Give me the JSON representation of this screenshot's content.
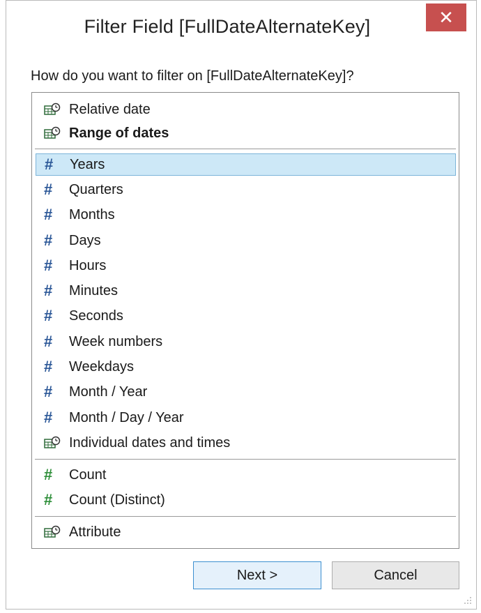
{
  "dialog": {
    "title": "Filter Field [FullDateAlternateKey]",
    "close_label": "✕",
    "prompt": "How do you want to filter on [FullDateAlternateKey]?"
  },
  "list": {
    "group1": [
      {
        "label": "Relative date",
        "icon": "date-time-icon",
        "bold": false
      },
      {
        "label": "Range of dates",
        "icon": "date-time-icon",
        "bold": true
      }
    ],
    "group2": [
      {
        "label": "Years",
        "icon": "hash-icon",
        "selected": true
      },
      {
        "label": "Quarters",
        "icon": "hash-icon"
      },
      {
        "label": "Months",
        "icon": "hash-icon"
      },
      {
        "label": "Days",
        "icon": "hash-icon"
      },
      {
        "label": "Hours",
        "icon": "hash-icon"
      },
      {
        "label": "Minutes",
        "icon": "hash-icon"
      },
      {
        "label": "Seconds",
        "icon": "hash-icon"
      },
      {
        "label": "Week numbers",
        "icon": "hash-icon"
      },
      {
        "label": "Weekdays",
        "icon": "hash-icon"
      },
      {
        "label": "Month / Year",
        "icon": "hash-icon"
      },
      {
        "label": "Month / Day / Year",
        "icon": "hash-icon"
      },
      {
        "label": "Individual dates and times",
        "icon": "date-time-icon"
      }
    ],
    "group3": [
      {
        "label": "Count",
        "icon": "hash-icon-green"
      },
      {
        "label": "Count (Distinct)",
        "icon": "hash-icon-green"
      }
    ],
    "group4": [
      {
        "label": "Attribute",
        "icon": "date-time-icon"
      }
    ]
  },
  "hash_symbol": "#",
  "buttons": {
    "next": "Next >",
    "cancel": "Cancel"
  },
  "colors": {
    "close_button": "#c7504f",
    "selection": "#cde8f7",
    "hash_blue": "#2b5797",
    "hash_green": "#2f8f3a"
  }
}
